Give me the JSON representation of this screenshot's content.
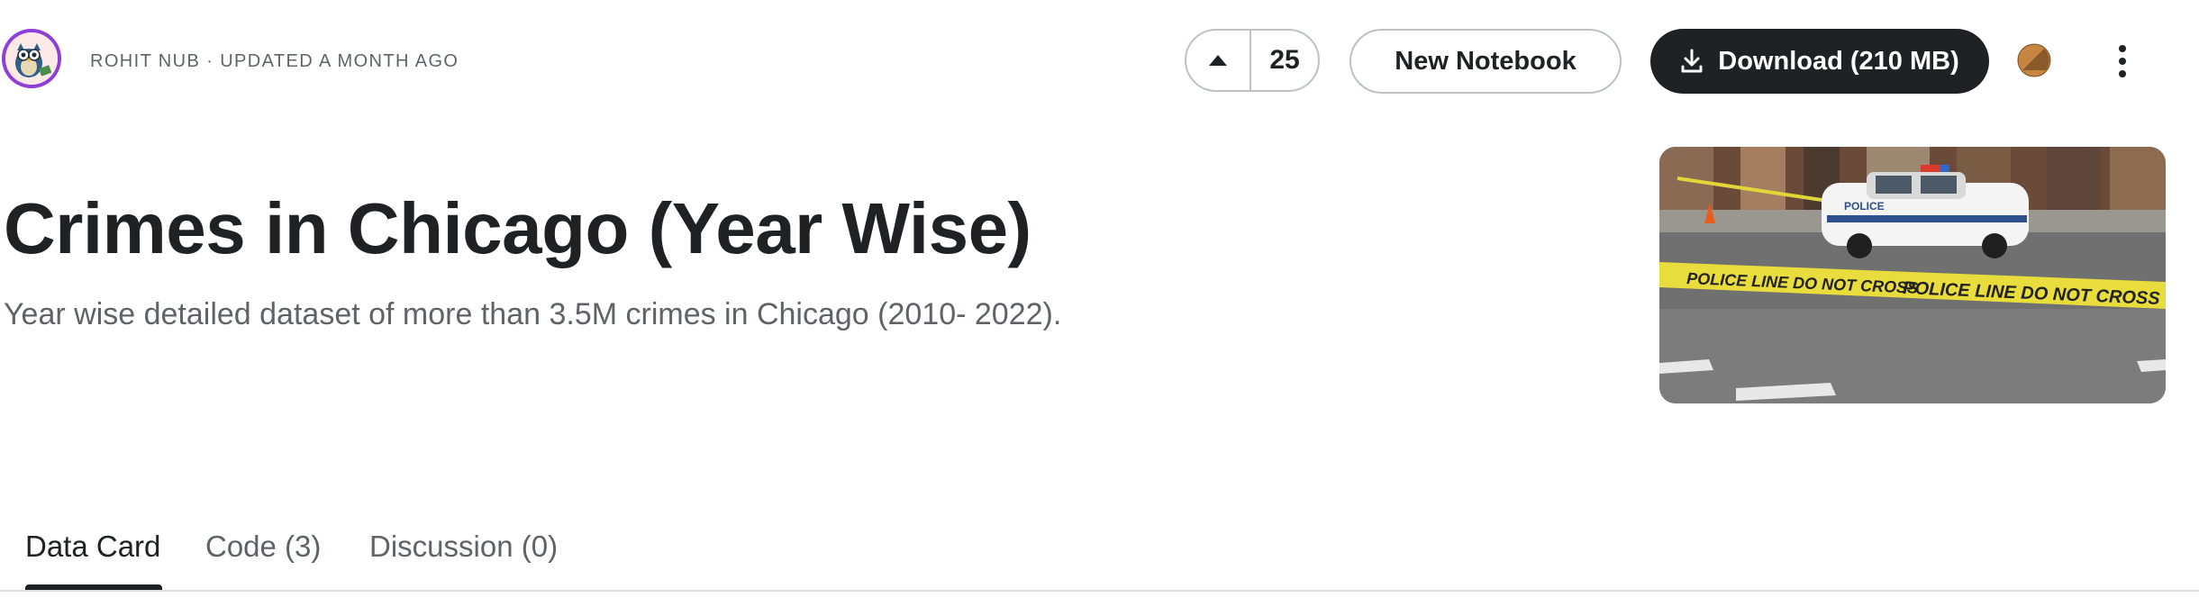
{
  "header": {
    "byline": "ROHIT NUB · UPDATED A MONTH AGO",
    "vote_count": "25",
    "new_notebook_label": "New Notebook",
    "download_label": "Download (210 MB)",
    "icons": {
      "avatar": "owl-avatar",
      "upvote": "caret-up-icon",
      "download": "download-icon",
      "status": "medal-icon",
      "menu": "more-vertical-icon"
    }
  },
  "dataset": {
    "title": "Crimes in Chicago (Year Wise)",
    "subtitle": "Year wise detailed dataset of more than 3.5M crimes in Chicago (2010- 2022).",
    "cover_tape_text": "POLICE LINE DO NOT CROSS",
    "cover_car_text": "POLICE"
  },
  "tabs": [
    {
      "label": "Data Card",
      "active": true
    },
    {
      "label": "Code (3)",
      "active": false
    },
    {
      "label": "Discussion (0)",
      "active": false
    }
  ],
  "colors": {
    "primary_dark": "#202124",
    "muted_text": "#5f6368",
    "border": "#bdc1c6",
    "avatar_ring": "#8c3fd9",
    "tape_yellow": "#e8dd3c"
  }
}
